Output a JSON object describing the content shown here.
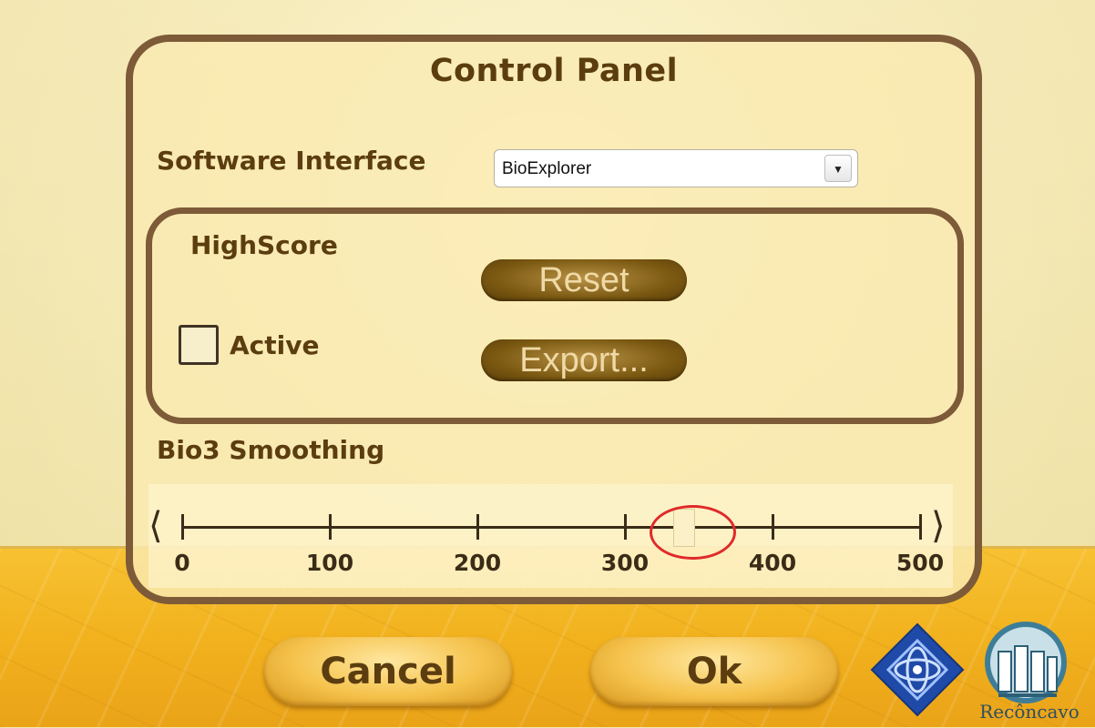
{
  "dialog": {
    "title": "Control Panel",
    "software_interface": {
      "label": "Software Interface",
      "selected": "BioExplorer"
    },
    "highscore": {
      "label": "HighScore",
      "reset_label": "Reset",
      "export_label": "Export...",
      "active_label": "Active",
      "active_checked": false
    },
    "smoothing": {
      "label": "Bio3 Smoothing",
      "min": 0,
      "max": 500,
      "value": 340,
      "ticks": [
        "0",
        "100",
        "200",
        "300",
        "400",
        "500"
      ]
    }
  },
  "footer": {
    "cancel_label": "Cancel",
    "ok_label": "Ok",
    "logo_text": "Recôncavo"
  },
  "colors": {
    "panel_border": "#7d5a38",
    "title_text": "#5b3d10",
    "highlight_ring": "#e02a2a",
    "floor": "#f2b21e"
  }
}
